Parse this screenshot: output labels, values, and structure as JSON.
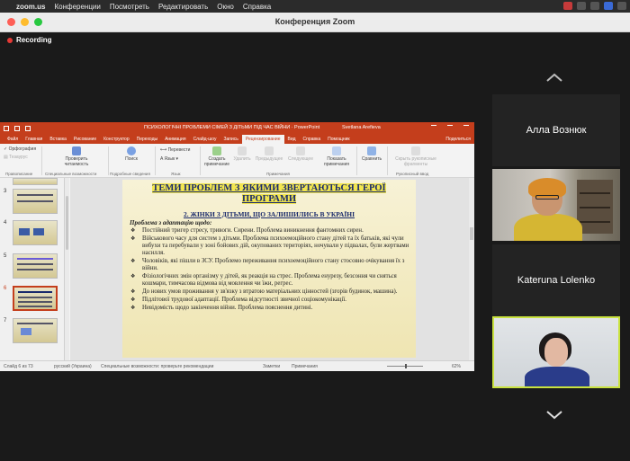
{
  "mac_menu": {
    "apple": "",
    "app": "zoom.us",
    "items": [
      "Конференции",
      "Посмотреть",
      "Редактировать",
      "Окно",
      "Справка"
    ]
  },
  "window": {
    "title": "Конференция Zoom"
  },
  "recording": {
    "label": "Recording"
  },
  "ppt": {
    "doc_title": "ПСИХОЛОГІЧНІ ПРОБЛЕМИ СІМЕЙ З ДІТЬМИ ПІД ЧАС ВІЙНИ  ·  PowerPoint",
    "user": "Svetlana Arefieva",
    "tabs": [
      "Файл",
      "Главная",
      "Вставка",
      "Рисование",
      "Конструктор",
      "Переходы",
      "Анимация",
      "Слайд-шоу",
      "Запись",
      "Рецензирование",
      "Вид",
      "Справка",
      "Помощник"
    ],
    "active_tab": "Рецензирование",
    "share": "Поделиться",
    "ribbon": {
      "spell": "Орфография",
      "thesaurus": "Тезаурус",
      "check_access": "Проверить читаемость",
      "search": "Поиск",
      "translate": "Перевести",
      "language": "Язык",
      "new_comment": "Создать примечание",
      "delete": "Удалить",
      "prev": "Предыдущее",
      "next": "Следующее",
      "show_comments": "Показать примечания",
      "compare": "Сравнить",
      "hide_ink": "Скрыть рукописные фрагменты",
      "groups": [
        "Правописание",
        "Специальные возможности",
        "Подробные сведения",
        "Язык",
        "Примечания",
        "Рукописный ввод"
      ]
    },
    "thumb_numbers": [
      "3",
      "4",
      "5",
      "6",
      "7"
    ],
    "selected_thumb": "6",
    "slide": {
      "title_line1": "ТЕМИ ПРОБЛЕМ З ЯКИМИ ЗВЕРТАЮТЬСЯ ГЕРОЇ",
      "title_line2": "ПРОГРАМИ",
      "subtitle": "2. ЖІНКИ З ДІТЬМИ, ЩО ЗАЛИШИЛИСЬ В УКРАЇНІ",
      "heading": "Проблема з адаптацію щодо:",
      "bullets": [
        "Постійний тригер стресу, тривоги. Сирени. Проблема виникнення фантомних сирен.",
        "Військового часу для систем з дітьми. Проблема психоемоційного стану дітей та їх батьків, які чули вибухи та перебували у зоні бойових дій, окупованих територіях, ночували у підвалах, були жертвами насилля.",
        "Чоловіків, які пішли в ЗСУ. Проблемо переживання психоемоційного стану стосовно очікування їх з війни.",
        "Фізіологічних змін організму у дітей, як реакція на стрес. Проблема енурезу, безсоння чи сняться кошмари, тимчасова відмова від мовлення чи їжи, регрес.",
        "До нових умов проживання у зв'язку з втратою матеріальних цінностей (згорів будинок, машина).",
        "Підлітової трудової адаптації. Проблема відсутності звичної соціокомунікації.",
        "Невідомість щодо закінчення війни. Проблема пояснення дитині."
      ]
    },
    "status": {
      "slide": "Слайд 6 из 73",
      "lang": "русский (Украина)",
      "access": "Специальные возможности: проверьте рекомендации",
      "notes": "Заметки",
      "comments": "Примечания",
      "zoom": "62%"
    }
  },
  "participants": [
    {
      "name": "Алла Вознюк",
      "video": false
    },
    {
      "name": "",
      "video": true
    },
    {
      "name": "Kateruna Lolenko",
      "video": false
    },
    {
      "name": "",
      "video": true,
      "active": true
    }
  ],
  "colors": {
    "ppt_red": "#c43e1c",
    "active_speaker": "#c9e23f"
  }
}
